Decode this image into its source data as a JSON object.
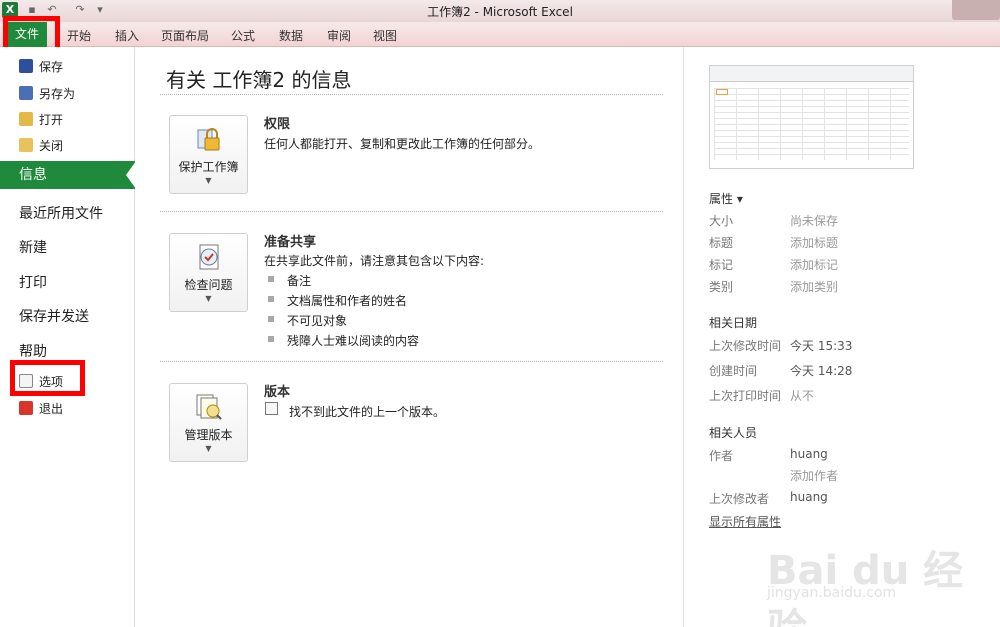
{
  "window": {
    "title": "工作簿2 - Microsoft Excel",
    "app_logo": "X"
  },
  "qat": {
    "icons": [
      "save-icon",
      "undo-icon",
      "redo-icon",
      "customize-icon"
    ]
  },
  "ribbon": {
    "file_tab": "文件",
    "tabs": [
      "开始",
      "插入",
      "页面布局",
      "公式",
      "数据",
      "审阅",
      "视图"
    ]
  },
  "nav": {
    "save": "保存",
    "save_as": "另存为",
    "open": "打开",
    "close": "关闭",
    "info": "信息",
    "recent": "最近所用文件",
    "new": "新建",
    "print": "打印",
    "save_send": "保存并发送",
    "help": "帮助",
    "options": "选项",
    "exit": "退出"
  },
  "main": {
    "title": "有关 工作簿2 的信息",
    "permissions": {
      "button": "保护工作簿",
      "heading": "权限",
      "text": "任何人都能打开、复制和更改此工作簿的任何部分。"
    },
    "prepare": {
      "button": "检查问题",
      "heading": "准备共享",
      "text": "在共享此文件前，请注意其包含以下内容:",
      "items": [
        "备注",
        "文档属性和作者的姓名",
        "不可见对象",
        "残障人士难以阅读的内容"
      ]
    },
    "versions": {
      "button": "管理版本",
      "heading": "版本",
      "text": "找不到此文件的上一个版本。"
    }
  },
  "properties": {
    "heading": "属性 ▾",
    "size_label": "大小",
    "size_value": "尚未保存",
    "title_label": "标题",
    "title_value": "添加标题",
    "tags_label": "标记",
    "tags_value": "添加标记",
    "category_label": "类别",
    "category_value": "添加类别",
    "dates_heading": "相关日期",
    "modified_label": "上次修改时间",
    "modified_value": "今天 15:33",
    "created_label": "创建时间",
    "created_value": "今天 14:28",
    "printed_label": "上次打印时间",
    "printed_value": "从不",
    "people_heading": "相关人员",
    "author_label": "作者",
    "author_value": "huang",
    "add_author": "添加作者",
    "lastmod_label": "上次修改者",
    "lastmod_value": "huang",
    "show_all": "显示所有属性"
  },
  "watermark": {
    "logo": "Bai du 经验",
    "url": "jingyan.baidu.com"
  },
  "colors": {
    "accent": "#1f8a3b",
    "highlight_box": "#ff0000"
  }
}
